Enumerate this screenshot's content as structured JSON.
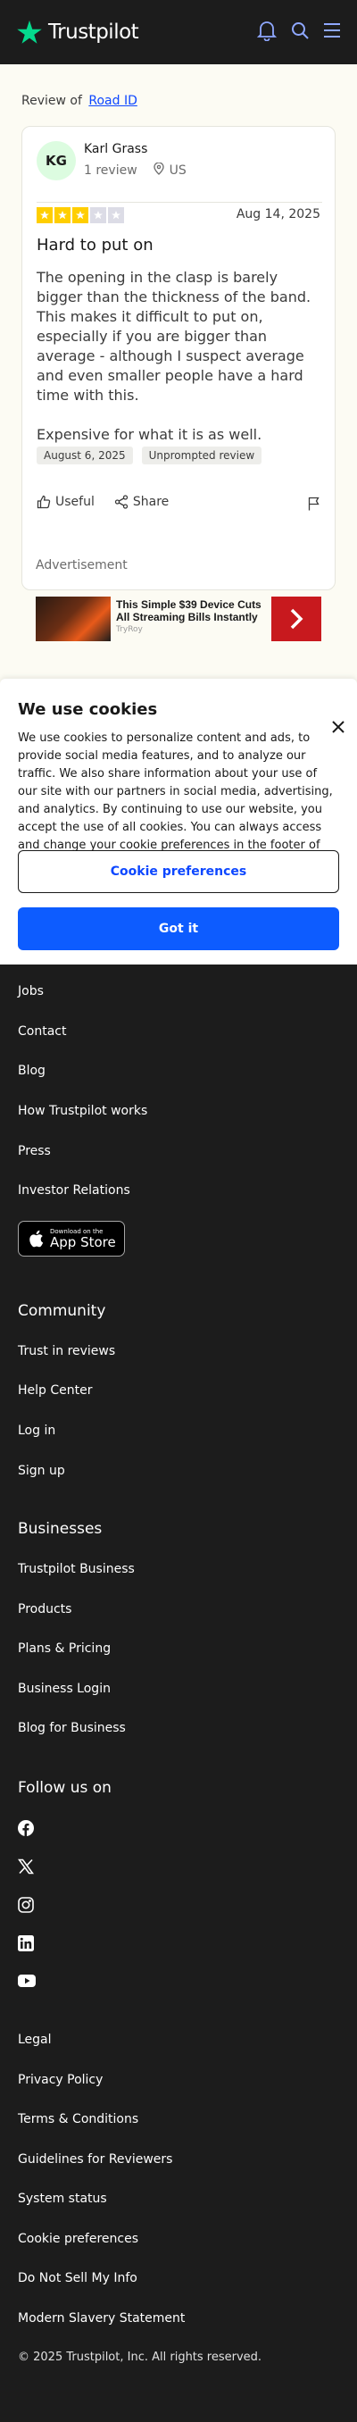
{
  "header": {
    "brand": "Trustpilot",
    "icons": [
      "bell-icon",
      "search-icon",
      "menu-icon"
    ],
    "accent_color": "#04da8d",
    "icon_color": "#8fa8ff"
  },
  "review_of": {
    "prefix": "Review of",
    "company": "Road ID"
  },
  "review": {
    "initials": "KG",
    "author": "Karl Grass",
    "reviews_count": "1 review",
    "country": "US",
    "rating": 3,
    "max_rating": 5,
    "star_color": "#ffce00",
    "date": "Aug 14, 2025",
    "title": "Hard to put on",
    "body": [
      "The opening in the clasp is barely bigger than the thickness of the band. This makes it difficult to put on, especially if you are bigger than average - although I suspect average and even smaller people have a hard time with this.",
      "Expensive for what it is as well."
    ],
    "tags": [
      "August 6, 2025",
      "Unprompted review"
    ],
    "actions": {
      "useful": "Useful",
      "share": "Share"
    }
  },
  "ad": {
    "label": "Advertisement",
    "title": "This Simple $39 Device Cuts All Streaming Bills Instantly",
    "source": "TryRoy"
  },
  "cookies": {
    "title": "We use cookies",
    "text": "We use cookies to personalize content and ads, to provide social media features, and to analyze our traffic. We also share information about your use of our site with our partners in social media, advertising, and analytics. By continuing to use our website, you accept the use of all cookies. You can always access and change your cookie preferences in the footer of this website.",
    "preferences_button": "Cookie preferences",
    "accept_button": "Got it"
  },
  "footer": {
    "about_links": [
      "Jobs",
      "Contact",
      "Blog",
      "How Trustpilot works",
      "Press",
      "Investor Relations"
    ],
    "app_store": {
      "small": "Download on the",
      "big": "App Store"
    },
    "community_title": "Community",
    "community_links": [
      "Trust in reviews",
      "Help Center",
      "Log in",
      "Sign up"
    ],
    "businesses_title": "Businesses",
    "business_links": [
      "Trustpilot Business",
      "Products",
      "Plans & Pricing",
      "Business Login",
      "Blog for Business"
    ],
    "follow_title": "Follow us on",
    "social_icons": [
      "facebook-icon",
      "x-icon",
      "instagram-icon",
      "linkedin-icon",
      "youtube-icon"
    ],
    "legal_links": [
      "Legal",
      "Privacy Policy",
      "Terms & Conditions",
      "Guidelines for Reviewers",
      "System status",
      "Cookie preferences",
      "Do Not Sell My Info",
      "Modern Slavery Statement"
    ],
    "copyright": "© 2025 Trustpilot, Inc. All rights reserved."
  }
}
